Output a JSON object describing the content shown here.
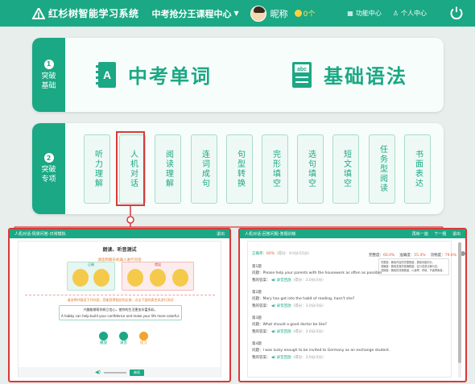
{
  "header": {
    "app_title": "红杉树智能学习系统",
    "course_menu": "中考抢分王课程中心",
    "nickname": "昵称",
    "coins": "0个",
    "function_center": "功能中心",
    "personal_center": "个人中心",
    "icons": {
      "logo": "tree-logo-icon",
      "function": "grid-icon",
      "person": "person-icon",
      "power": "power-icon"
    }
  },
  "section1": {
    "num": "1",
    "label_line1": "突破",
    "label_line2": "基础",
    "items": [
      {
        "label": "中考单词",
        "icon": "vocabulary-book-icon"
      },
      {
        "label": "基础语法",
        "icon": "grammar-book-icon"
      }
    ]
  },
  "section2": {
    "num": "2",
    "label_line1": "突破",
    "label_line2": "专项",
    "skills": [
      "听力理解",
      "人机对话",
      "阅读理解",
      "连词成句",
      "句型转换",
      "完形填空",
      "选句填空",
      "短文填空",
      "任务型阅读",
      "书面表达"
    ]
  },
  "left_panel": {
    "header_title": "人机对话-情景问答-日常模拟",
    "header_right": "退出",
    "card_title": "朗读、听音测试",
    "tip": "请您和聊天机器人进行对话",
    "group_a_label": "正确",
    "group_b_label": "错误",
    "instruction": "请选择并跟读下列内容，您能获得相应的反馈，点击下面的麦克风进行测试",
    "sentence_cn": "兴趣能够帮你树立信心，使你的生活更加丰富多彩。",
    "sentence_en": "A hobby can help build your confidence and make your life more colorful.",
    "buttons": [
      "播放",
      "录音",
      "提交"
    ],
    "bottom_button": "继续"
  },
  "right_panel": {
    "header_title": "人机对话-回答问题-答题训练",
    "header_links": [
      "再练一遍",
      "下一题",
      "退出"
    ],
    "accuracy_label": "正确率：",
    "accuracy_value": "60%",
    "score_text": "（得分：9.0分/15分）",
    "sub_stats": [
      {
        "label": "完整度：",
        "value": "60.0%"
      },
      {
        "label": "准确度：",
        "value": "55.4%"
      },
      {
        "label": "流畅度：",
        "value": "79.6%"
      }
    ],
    "popup_lines": [
      "完整度：朗读内容的完整程度，漏读将被扣分。",
      "准确度：朗读发音的准确程度，区分发音正确与否。",
      "流畅度：朗读的流畅程度，以速率、停顿、节奏等衡量。"
    ],
    "my_answer": "我的答案：",
    "play_text": "录音回放",
    "q_label": "问题：",
    "questions": [
      {
        "no": "第1题",
        "text": "Please help your parents with the housework as often as possible.",
        "score": "（得分：3.0分/3分）"
      },
      {
        "no": "第2题",
        "text": "Mary has got into the habit of reading, hasn't she?",
        "score": "（得分：3.0分/3分）"
      },
      {
        "no": "第3题",
        "text": "What should a good doctor be like?",
        "score": "（得分：3.0分/3分）"
      },
      {
        "no": "第4题",
        "text": "I was lucky enough to be invited to Germany as an exchange student.",
        "score": "（得分：3.0分/3分）"
      }
    ]
  }
}
